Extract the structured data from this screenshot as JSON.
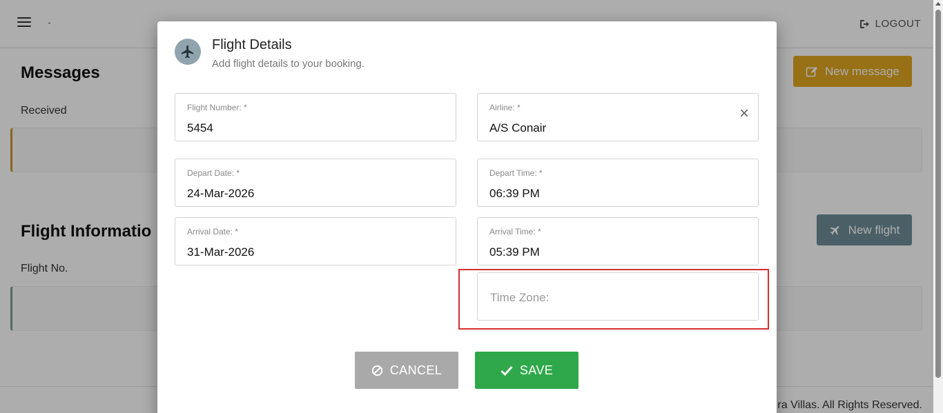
{
  "header": {
    "brand_text": "-",
    "logout_label": "LOGOUT"
  },
  "background": {
    "messages_title": "Messages",
    "messages_sub": "Received",
    "new_message_label": "New message",
    "flight_info_title": "Flight Informatio",
    "flight_info_sub": "Flight No.",
    "new_flight_label": "New flight",
    "footer_text": "ra Villas. All Rights Reserved."
  },
  "modal": {
    "title": "Flight Details",
    "subtitle": "Add flight details to your booking.",
    "fields": {
      "flight_number": {
        "label": "Flight Number: *",
        "value": "5454"
      },
      "airline": {
        "label": "Airline: *",
        "value": "A/S Conair"
      },
      "depart_date": {
        "label": "Depart Date: *",
        "value": "24-Mar-2026"
      },
      "depart_time": {
        "label": "Depart Time: *",
        "value": "06:39 PM"
      },
      "arrival_date": {
        "label": "Arrival Date: *",
        "value": "31-Mar-2026"
      },
      "arrival_time": {
        "label": "Arrival Time: *",
        "value": "05:39 PM"
      },
      "time_zone": {
        "placeholder": "Time Zone:"
      }
    },
    "cancel_label": "CANCEL",
    "save_label": "SAVE"
  },
  "colors": {
    "save": "#2ea84a",
    "cancel": "#a9a9a9",
    "highlight": "#d32f2f",
    "new_message": "#e0a520",
    "new_flight": "#6f8e97"
  }
}
